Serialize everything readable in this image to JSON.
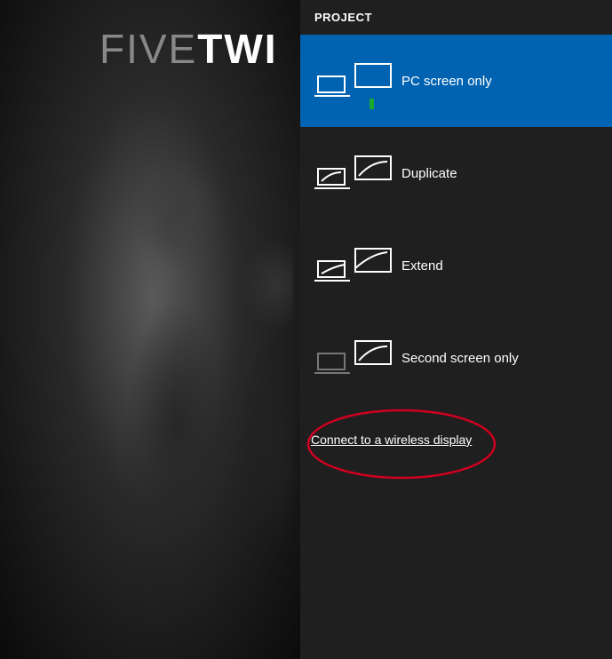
{
  "wallpaper": {
    "text_thin": "FIVE",
    "text_bold": "TWI"
  },
  "panel": {
    "title": "PROJECT",
    "options": [
      {
        "label": "PC screen only",
        "selected": true
      },
      {
        "label": "Duplicate",
        "selected": false
      },
      {
        "label": "Extend",
        "selected": false
      },
      {
        "label": "Second screen only",
        "selected": false
      }
    ],
    "connect_link": "Connect to a wireless display"
  },
  "annotation": {
    "circle_color": "#d00020"
  }
}
